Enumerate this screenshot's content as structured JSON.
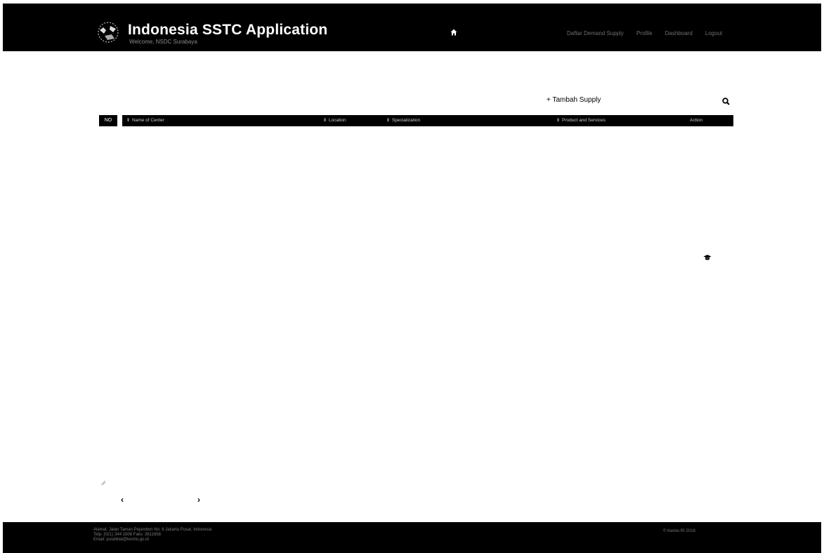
{
  "header": {
    "title": "Indonesia SSTC Application",
    "subtitle": "Welcome, NSDC Surabaya",
    "nav": [
      "Daftar Demand Supply",
      "Profile",
      "Dashboard",
      "Logout"
    ]
  },
  "toolbar": {
    "add_label": "+ Tambah Supply"
  },
  "table": {
    "columns": [
      "NO",
      "Name of Center",
      "Location",
      "Specialization",
      "Product and Services",
      "Action"
    ],
    "rows": []
  },
  "footer": {
    "lines": [
      "Alamat: Jalan Taman Pejambon No. 6 Jakarta Pusat, Indonesia",
      "Telp: (021) 344 1508 Faks: 3811658",
      "Email: pusdiklat@kemlu.go.id"
    ],
    "right": "© Kemlu RI 2016"
  },
  "colors": {
    "header_bg": "#000000",
    "page_bg": "#ffffff",
    "footer_bg": "#000000"
  }
}
